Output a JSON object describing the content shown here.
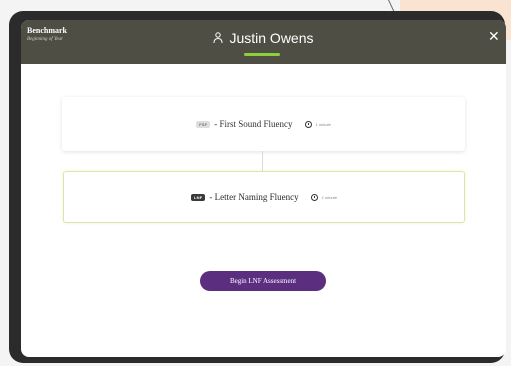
{
  "header": {
    "brand_title": "Benchmark",
    "brand_subtitle": "Beginning of Year",
    "student_name": "Justin Owens",
    "close_glyph": "✕",
    "accent_color": "#8ccf3a",
    "bar_color": "#4e4e44"
  },
  "assessments": [
    {
      "badge": "FSF",
      "name": "- First Sound Fluency",
      "time": "1 minute",
      "icon": "clock-icon"
    },
    {
      "badge": "LNF",
      "name": "- Letter Naming Fluency",
      "time": "1 minute",
      "icon": "clock-icon"
    }
  ],
  "action": {
    "begin_label": "Begin LNF Assessment",
    "button_color": "#5b2e80"
  }
}
